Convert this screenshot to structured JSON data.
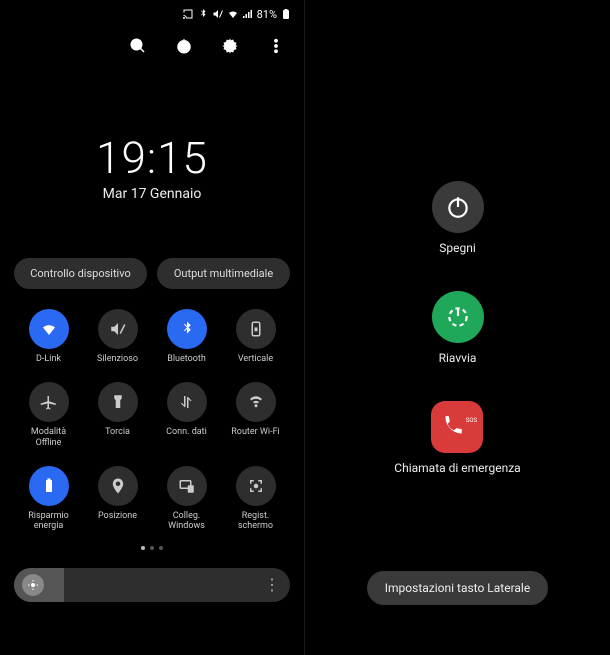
{
  "status": {
    "battery_pct": "81%"
  },
  "clock": {
    "time": "19:15",
    "date": "Mar 17 Gennaio"
  },
  "pills": {
    "device_control": "Controllo dispositivo",
    "media_output": "Output multimediale"
  },
  "quick_settings": [
    {
      "label": "D-Link",
      "icon": "wifi",
      "active": true
    },
    {
      "label": "Silenzioso",
      "icon": "mute",
      "active": false
    },
    {
      "label": "Bluetooth",
      "icon": "bluetooth",
      "active": true
    },
    {
      "label": "Verticale",
      "icon": "lock-rotation",
      "active": false
    },
    {
      "label": "Modalità Offline",
      "icon": "airplane",
      "active": false
    },
    {
      "label": "Torcia",
      "icon": "flashlight",
      "active": false
    },
    {
      "label": "Conn. dati",
      "icon": "data",
      "active": false
    },
    {
      "label": "Router Wi-Fi",
      "icon": "hotspot",
      "active": false
    },
    {
      "label": "Risparmio energia",
      "icon": "battery-saver",
      "active": true
    },
    {
      "label": "Posizione",
      "icon": "location",
      "active": false
    },
    {
      "label": "Colleg. Windows",
      "icon": "windows-link",
      "active": false
    },
    {
      "label": "Regist. schermo",
      "icon": "screen-record",
      "active": false
    }
  ],
  "power_menu": {
    "power_off": {
      "label": "Spegni",
      "color": "#3a3a3a"
    },
    "restart": {
      "label": "Riavvia",
      "color": "#1fa85a"
    },
    "emergency": {
      "label": "Chiamata di emergenza",
      "color": "#d93a3a",
      "badge": "SOS"
    },
    "side_button": "Impostazioni tasto Laterale"
  }
}
